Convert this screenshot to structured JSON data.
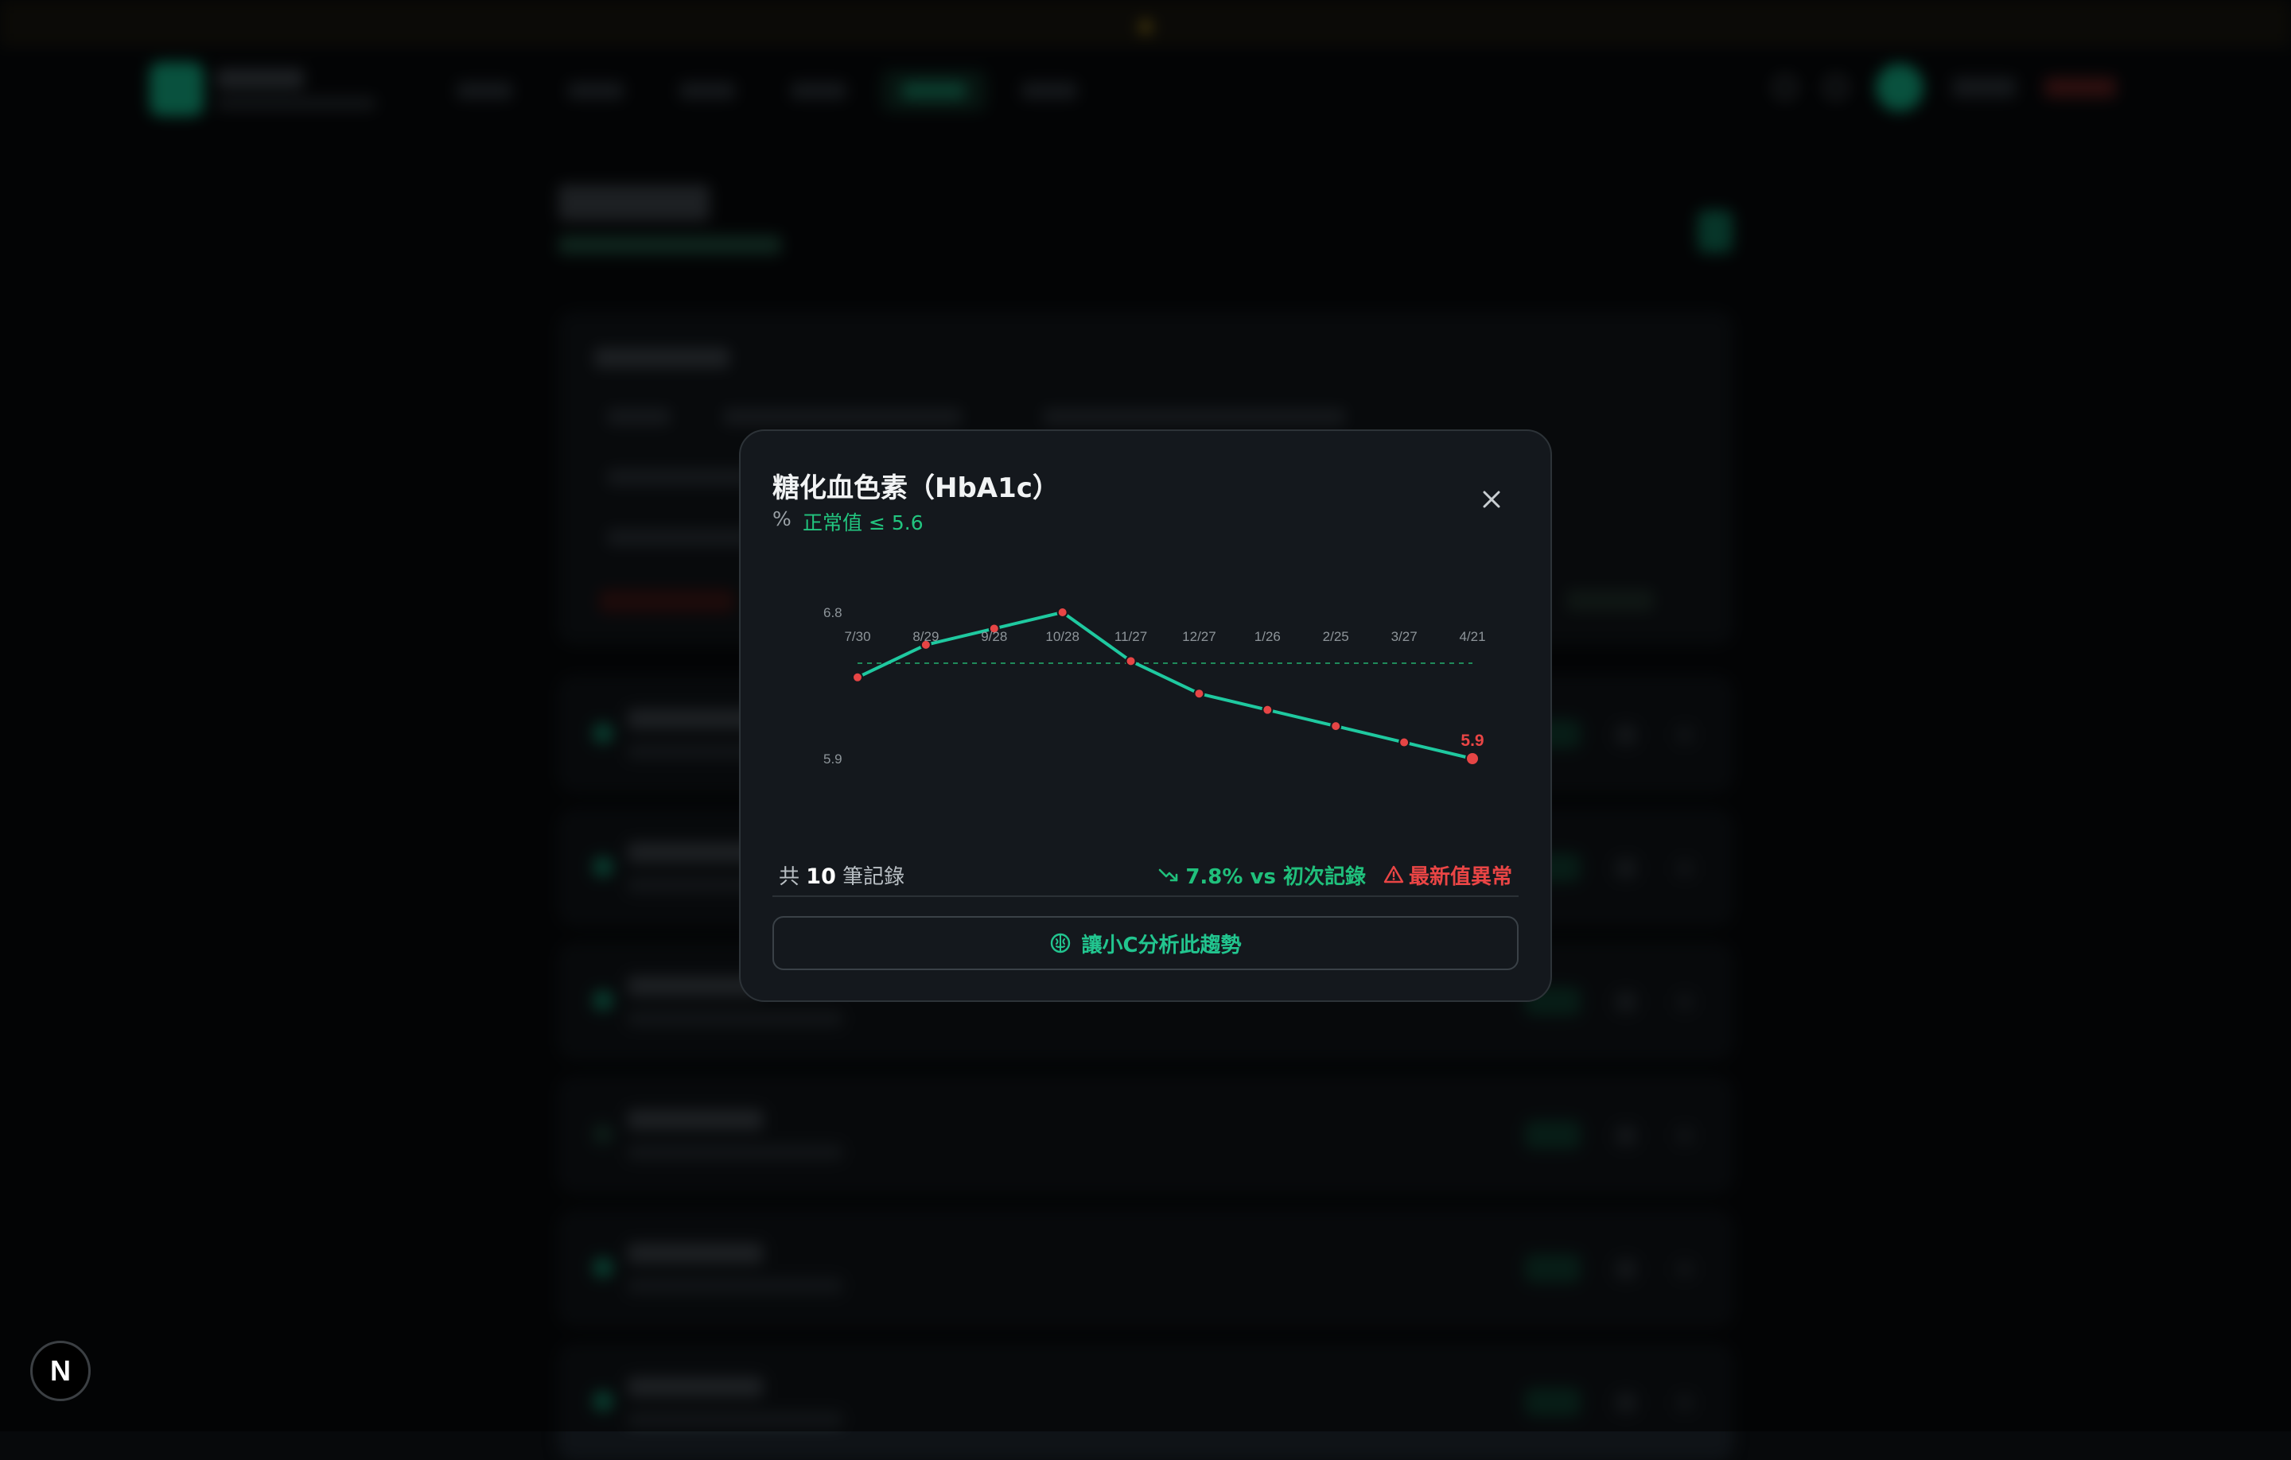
{
  "modal": {
    "title": "糖化血色素（HbA1c）",
    "unit": "%",
    "normal_range": "正常值 ≤ 5.6",
    "count_prefix": "共",
    "count": "10",
    "count_suffix": "筆記錄",
    "trend_text": "7.8% vs 初次記錄",
    "abnormal_text": "最新值異常",
    "ai_button_label": "讓小C分析此趨勢"
  },
  "icons": {
    "close": "close-icon",
    "trend": "trending-down-icon",
    "warning": "warning-triangle-icon",
    "ai": "brain-icon",
    "next": "nextjs-logo-icon"
  },
  "colors": {
    "line": "#1fc9a0",
    "point": "#e64545",
    "normal": "#22c57f",
    "threshold": "#1f8a5a",
    "abnormal": "#ea4545"
  },
  "next_badge": "N",
  "chart_data": {
    "type": "line",
    "x": [
      "7/30",
      "8/29",
      "9/28",
      "10/28",
      "11/27",
      "12/27",
      "1/26",
      "2/25",
      "3/27",
      "4/21"
    ],
    "values": [
      6.4,
      6.6,
      6.7,
      6.8,
      6.5,
      6.3,
      6.2,
      6.1,
      6.0,
      5.9
    ],
    "y_tick_labels": [
      "6.8",
      "5.9"
    ],
    "last_value_label": "5.9",
    "threshold": 5.6,
    "ylim": [
      5.6,
      6.8
    ]
  }
}
